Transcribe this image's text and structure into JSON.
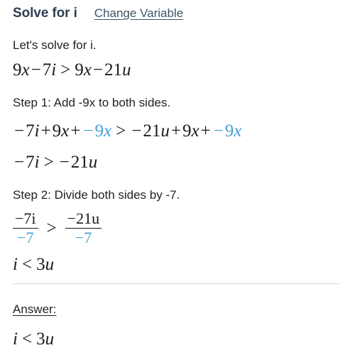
{
  "header": {
    "title": "Solve for i",
    "change_variable_link": "Change Variable"
  },
  "intro": {
    "text": "Let's solve for i."
  },
  "equation_original": {
    "lhs_coeff_x": "9",
    "lhs_var_x": "x",
    "lhs_minus": "−",
    "lhs_coeff_i": "7",
    "lhs_var_i": "i",
    "relation": ">",
    "rhs_coeff_x": "9",
    "rhs_var_x": "x",
    "rhs_minus": "−",
    "rhs_coeff_u": "21",
    "rhs_var_u": "u",
    "plain": "9x − 7i > 9x − 21u"
  },
  "step1": {
    "label": "Step 1: Add -9x to both sides.",
    "line": {
      "t1_minus": "−",
      "t1_coeff": "7",
      "t1_var": "i",
      "t2_plus": "+",
      "t2_coeff": "9",
      "t2_var": "x",
      "t3_plus": "+",
      "t3_highlight_minus": "−",
      "t3_highlight_coeff": "9",
      "t3_highlight_var": "x",
      "relation": ">",
      "t4_minus": "−",
      "t4_coeff": "21",
      "t4_var": "u",
      "t5_plus": "+",
      "t5_coeff": "9",
      "t5_var": "x",
      "t6_plus": "+",
      "t6_highlight_minus": "−",
      "t6_highlight_coeff": "9",
      "t6_highlight_var": "x",
      "plain": "−7i + 9x + −9x > −21u + 9x + −9x"
    },
    "result": {
      "lhs_minus": "−",
      "lhs_coeff": "7",
      "lhs_var": "i",
      "relation": ">",
      "rhs_minus": "−",
      "rhs_coeff": "21",
      "rhs_var": "u",
      "plain": "−7i > −21u"
    }
  },
  "step2": {
    "label": "Step 2: Divide both sides by -7.",
    "fraction_left": {
      "numerator_minus": "−",
      "numerator_coeff": "7",
      "numerator_var": "i",
      "denominator": "−7"
    },
    "relation": ">",
    "fraction_right": {
      "numerator_minus": "−",
      "numerator_coeff": "21",
      "numerator_var": "u",
      "denominator": "−7"
    },
    "result": {
      "lhs_var": "i",
      "relation": "<",
      "rhs_coeff": "3",
      "rhs_var": "u",
      "plain": "i < 3u"
    }
  },
  "answer": {
    "label": "Answer:",
    "value": {
      "lhs_var": "i",
      "relation": "<",
      "rhs_coeff": "3",
      "rhs_var": "u",
      "plain": "i < 3u"
    }
  },
  "colors": {
    "title": "#2d3e50",
    "link": "#3d5564",
    "body_text": "#231f20",
    "math_text": "#1a1a1a",
    "highlight_blue": "#4a9fd4",
    "divider": "#d8d8d8",
    "background": "#ffffff"
  }
}
